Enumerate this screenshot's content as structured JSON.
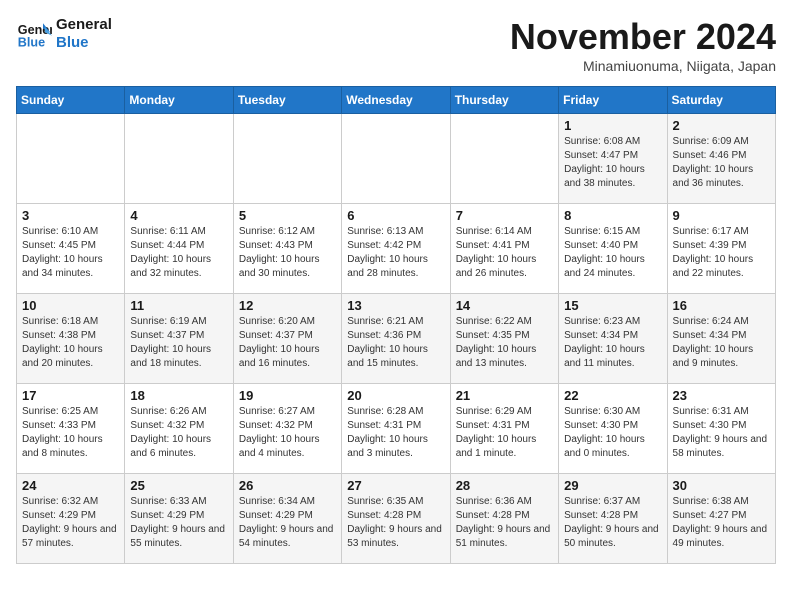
{
  "logo": {
    "line1": "General",
    "line2": "Blue"
  },
  "title": "November 2024",
  "location": "Minamiuonuma, Niigata, Japan",
  "days_of_week": [
    "Sunday",
    "Monday",
    "Tuesday",
    "Wednesday",
    "Thursday",
    "Friday",
    "Saturday"
  ],
  "weeks": [
    [
      {
        "day": "",
        "content": ""
      },
      {
        "day": "",
        "content": ""
      },
      {
        "day": "",
        "content": ""
      },
      {
        "day": "",
        "content": ""
      },
      {
        "day": "",
        "content": ""
      },
      {
        "day": "1",
        "content": "Sunrise: 6:08 AM\nSunset: 4:47 PM\nDaylight: 10 hours and 38 minutes."
      },
      {
        "day": "2",
        "content": "Sunrise: 6:09 AM\nSunset: 4:46 PM\nDaylight: 10 hours and 36 minutes."
      }
    ],
    [
      {
        "day": "3",
        "content": "Sunrise: 6:10 AM\nSunset: 4:45 PM\nDaylight: 10 hours and 34 minutes."
      },
      {
        "day": "4",
        "content": "Sunrise: 6:11 AM\nSunset: 4:44 PM\nDaylight: 10 hours and 32 minutes."
      },
      {
        "day": "5",
        "content": "Sunrise: 6:12 AM\nSunset: 4:43 PM\nDaylight: 10 hours and 30 minutes."
      },
      {
        "day": "6",
        "content": "Sunrise: 6:13 AM\nSunset: 4:42 PM\nDaylight: 10 hours and 28 minutes."
      },
      {
        "day": "7",
        "content": "Sunrise: 6:14 AM\nSunset: 4:41 PM\nDaylight: 10 hours and 26 minutes."
      },
      {
        "day": "8",
        "content": "Sunrise: 6:15 AM\nSunset: 4:40 PM\nDaylight: 10 hours and 24 minutes."
      },
      {
        "day": "9",
        "content": "Sunrise: 6:17 AM\nSunset: 4:39 PM\nDaylight: 10 hours and 22 minutes."
      }
    ],
    [
      {
        "day": "10",
        "content": "Sunrise: 6:18 AM\nSunset: 4:38 PM\nDaylight: 10 hours and 20 minutes."
      },
      {
        "day": "11",
        "content": "Sunrise: 6:19 AM\nSunset: 4:37 PM\nDaylight: 10 hours and 18 minutes."
      },
      {
        "day": "12",
        "content": "Sunrise: 6:20 AM\nSunset: 4:37 PM\nDaylight: 10 hours and 16 minutes."
      },
      {
        "day": "13",
        "content": "Sunrise: 6:21 AM\nSunset: 4:36 PM\nDaylight: 10 hours and 15 minutes."
      },
      {
        "day": "14",
        "content": "Sunrise: 6:22 AM\nSunset: 4:35 PM\nDaylight: 10 hours and 13 minutes."
      },
      {
        "day": "15",
        "content": "Sunrise: 6:23 AM\nSunset: 4:34 PM\nDaylight: 10 hours and 11 minutes."
      },
      {
        "day": "16",
        "content": "Sunrise: 6:24 AM\nSunset: 4:34 PM\nDaylight: 10 hours and 9 minutes."
      }
    ],
    [
      {
        "day": "17",
        "content": "Sunrise: 6:25 AM\nSunset: 4:33 PM\nDaylight: 10 hours and 8 minutes."
      },
      {
        "day": "18",
        "content": "Sunrise: 6:26 AM\nSunset: 4:32 PM\nDaylight: 10 hours and 6 minutes."
      },
      {
        "day": "19",
        "content": "Sunrise: 6:27 AM\nSunset: 4:32 PM\nDaylight: 10 hours and 4 minutes."
      },
      {
        "day": "20",
        "content": "Sunrise: 6:28 AM\nSunset: 4:31 PM\nDaylight: 10 hours and 3 minutes."
      },
      {
        "day": "21",
        "content": "Sunrise: 6:29 AM\nSunset: 4:31 PM\nDaylight: 10 hours and 1 minute."
      },
      {
        "day": "22",
        "content": "Sunrise: 6:30 AM\nSunset: 4:30 PM\nDaylight: 10 hours and 0 minutes."
      },
      {
        "day": "23",
        "content": "Sunrise: 6:31 AM\nSunset: 4:30 PM\nDaylight: 9 hours and 58 minutes."
      }
    ],
    [
      {
        "day": "24",
        "content": "Sunrise: 6:32 AM\nSunset: 4:29 PM\nDaylight: 9 hours and 57 minutes."
      },
      {
        "day": "25",
        "content": "Sunrise: 6:33 AM\nSunset: 4:29 PM\nDaylight: 9 hours and 55 minutes."
      },
      {
        "day": "26",
        "content": "Sunrise: 6:34 AM\nSunset: 4:29 PM\nDaylight: 9 hours and 54 minutes."
      },
      {
        "day": "27",
        "content": "Sunrise: 6:35 AM\nSunset: 4:28 PM\nDaylight: 9 hours and 53 minutes."
      },
      {
        "day": "28",
        "content": "Sunrise: 6:36 AM\nSunset: 4:28 PM\nDaylight: 9 hours and 51 minutes."
      },
      {
        "day": "29",
        "content": "Sunrise: 6:37 AM\nSunset: 4:28 PM\nDaylight: 9 hours and 50 minutes."
      },
      {
        "day": "30",
        "content": "Sunrise: 6:38 AM\nSunset: 4:27 PM\nDaylight: 9 hours and 49 minutes."
      }
    ]
  ]
}
